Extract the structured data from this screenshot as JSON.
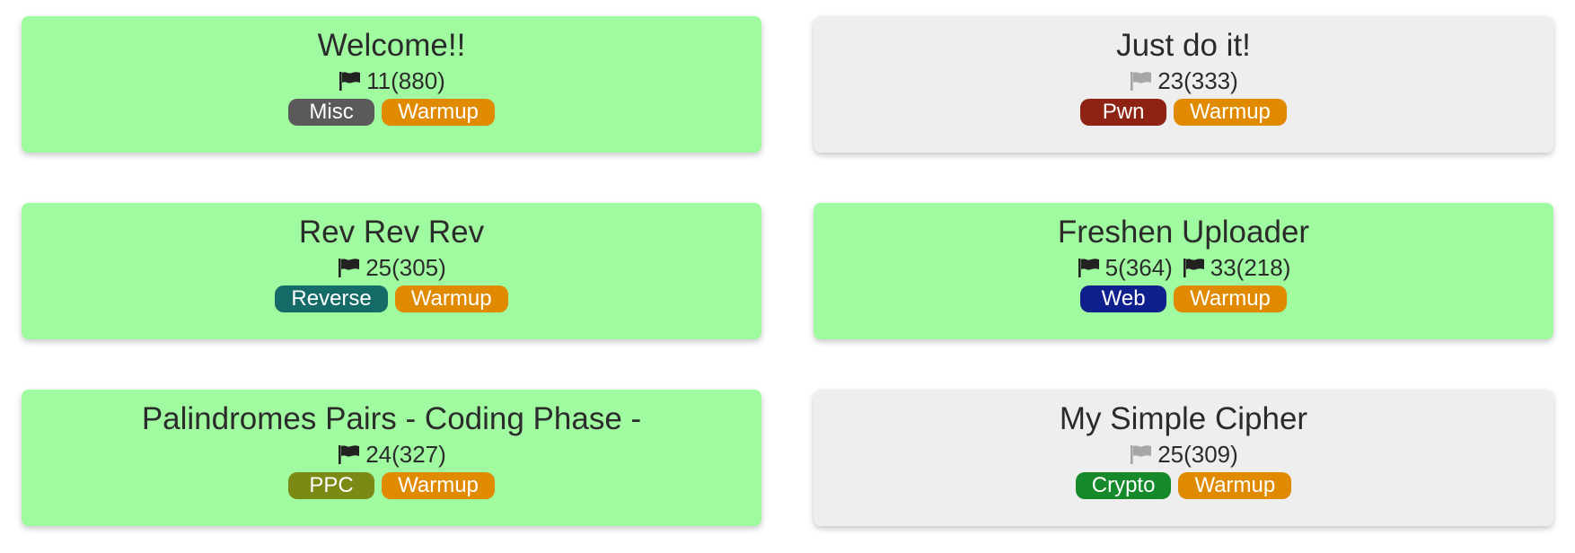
{
  "challenges": [
    {
      "title": "Welcome!!",
      "solved": true,
      "solves": [
        {
          "flag": "flag-black",
          "text": "11(880)"
        }
      ],
      "tags": [
        {
          "label": "Misc",
          "color": "#5a5a5a"
        },
        {
          "label": "Warmup",
          "color": "#e08a00"
        }
      ]
    },
    {
      "title": "Just do it!",
      "solved": false,
      "solves": [
        {
          "flag": "flag-gray",
          "text": "23(333)"
        }
      ],
      "tags": [
        {
          "label": "Pwn",
          "color": "#8e2213"
        },
        {
          "label": "Warmup",
          "color": "#e08a00"
        }
      ]
    },
    {
      "title": "Rev Rev Rev",
      "solved": true,
      "solves": [
        {
          "flag": "flag-black",
          "text": "25(305)"
        }
      ],
      "tags": [
        {
          "label": "Reverse",
          "color": "#146b67"
        },
        {
          "label": "Warmup",
          "color": "#e08a00"
        }
      ]
    },
    {
      "title": "Freshen Uploader",
      "solved": true,
      "solves": [
        {
          "flag": "flag-black",
          "text": "5(364)"
        },
        {
          "flag": "flag-black",
          "text": "33(218)"
        }
      ],
      "tags": [
        {
          "label": "Web",
          "color": "#0f1f8c"
        },
        {
          "label": "Warmup",
          "color": "#e08a00"
        }
      ]
    },
    {
      "title": "Palindromes Pairs - Coding Phase -",
      "solved": true,
      "solves": [
        {
          "flag": "flag-black",
          "text": "24(327)"
        }
      ],
      "tags": [
        {
          "label": "PPC",
          "color": "#7a8a14"
        },
        {
          "label": "Warmup",
          "color": "#e08a00"
        }
      ]
    },
    {
      "title": "My Simple Cipher",
      "solved": false,
      "solves": [
        {
          "flag": "flag-gray",
          "text": "25(309)"
        }
      ],
      "tags": [
        {
          "label": "Crypto",
          "color": "#168a2a"
        },
        {
          "label": "Warmup",
          "color": "#e08a00"
        }
      ]
    }
  ],
  "colors": {
    "solved_bg": "#a0fba0",
    "unsolved_bg": "#eeeeee",
    "flag_black": "#222222",
    "flag_gray": "#a6a6a6"
  }
}
